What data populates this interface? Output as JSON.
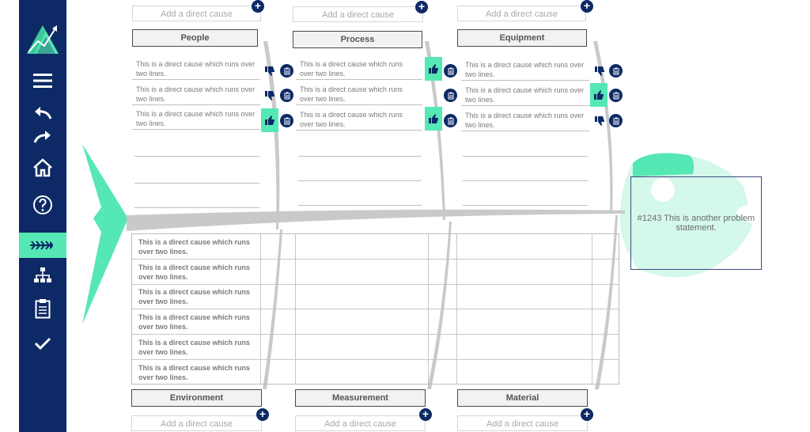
{
  "colors": {
    "sidebar_bg": "#0d2a66",
    "accent": "#56e8b4",
    "fish": "#56e8b4",
    "button": "#0d2a66"
  },
  "sidebar": {
    "logo": "mountain-logo",
    "items": [
      {
        "name": "menu",
        "icon": "hamburger-icon"
      },
      {
        "name": "undo",
        "icon": "undo-icon"
      },
      {
        "name": "redo",
        "icon": "redo-icon"
      },
      {
        "name": "home",
        "icon": "home-icon"
      },
      {
        "name": "help",
        "icon": "help-icon"
      },
      {
        "name": "fishbone",
        "icon": "fishbone-icon",
        "active": true
      },
      {
        "name": "hierarchy",
        "icon": "hierarchy-icon"
      },
      {
        "name": "clipboard",
        "icon": "clipboard-icon"
      },
      {
        "name": "complete",
        "icon": "check-icon"
      }
    ]
  },
  "add_placeholder": "Add a direct cause",
  "top_categories": [
    {
      "label": "People",
      "causes": [
        "This is a direct cause which runs over two lines.",
        "This is a direct cause which runs over two lines.",
        "This is a direct cause which runs over two lines."
      ]
    },
    {
      "label": "Process",
      "causes": [
        "This is a direct cause which runs over two lines.",
        "This is a direct cause which runs over two lines.",
        "This is a direct cause which runs over two lines."
      ]
    },
    {
      "label": "Equipment",
      "causes": [
        "This is a direct cause which runs over two lines.",
        "This is a direct cause which runs over two lines.",
        "This is a direct cause which runs over two lines."
      ]
    }
  ],
  "bottom_categories": [
    {
      "label": "Environment"
    },
    {
      "label": "Measurement"
    },
    {
      "label": "Material"
    }
  ],
  "table_rows": [
    "This is a direct cause which runs over two lines.",
    "This is a direct cause which runs over two lines.",
    "This is a direct cause which runs over two lines.",
    "This is a direct cause which runs over two lines.",
    "This is a direct cause which runs over two lines.",
    "This is a direct cause which runs over two lines."
  ],
  "problem_statement": "#1243 This is another problem statement."
}
